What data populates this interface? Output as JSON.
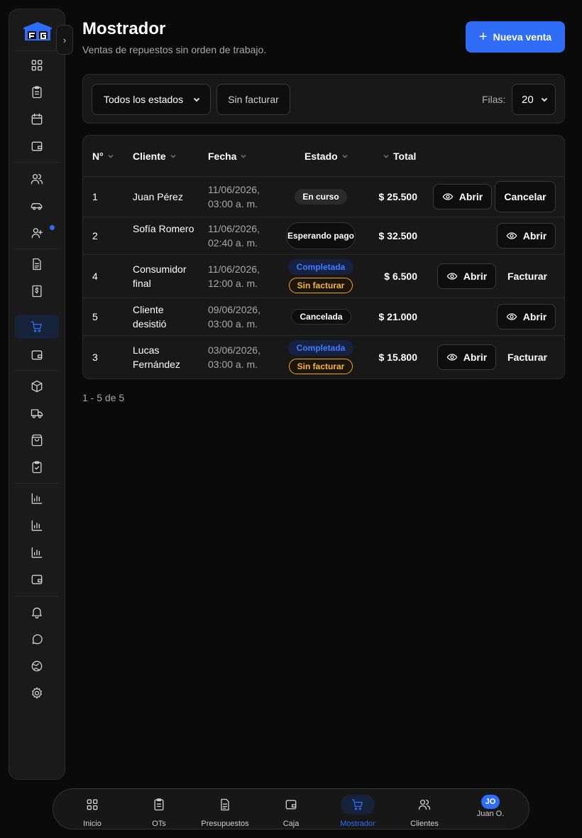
{
  "header": {
    "title": "Mostrador",
    "subtitle": "Ventas de repuestos sin orden de trabajo.",
    "new_sale": "Nueva venta"
  },
  "filters": {
    "estado_selected": "Todos los estados",
    "sin_facturar": "Sin facturar",
    "filas_label": "Filas:",
    "filas_value": "20"
  },
  "table": {
    "columns": {
      "num": "N°",
      "cliente": "Cliente",
      "fecha": "Fecha",
      "estado": "Estado",
      "total": "Total"
    },
    "rows": [
      {
        "num": "1",
        "cliente": "Juan Pérez",
        "fecha": "11/06/2026, 03:00 a. m.",
        "estado": "En curso",
        "total": "$ 25.500",
        "abrir": "Abrir",
        "extra": "Cancelar"
      },
      {
        "num": "2",
        "cliente": "Sofía Romero",
        "fecha": "11/06/2026, 02:40 a. m.",
        "estado": "Esperando pago",
        "total": "$ 32.500",
        "abrir": "Abrir"
      },
      {
        "num": "4",
        "cliente": "Consumidor final",
        "fecha": "11/06/2026, 12:00 a. m.",
        "estado": "Completada",
        "estado2": "Sin facturar",
        "total": "$ 6.500",
        "abrir": "Abrir",
        "extra": "Facturar"
      },
      {
        "num": "5",
        "cliente": "Cliente desistió",
        "fecha": "09/06/2026, 03:00 a. m.",
        "estado": "Cancelada",
        "total": "$ 21.000",
        "abrir": "Abrir"
      },
      {
        "num": "3",
        "cliente": "Lucas Fernández",
        "fecha": "03/06/2026, 03:00 a. m.",
        "estado": "Completada",
        "estado2": "Sin facturar",
        "total": "$ 15.800",
        "abrir": "Abrir",
        "extra": "Facturar"
      }
    ]
  },
  "pagination": "1 - 5 de 5",
  "bottom_nav": {
    "items": [
      "Inicio",
      "OTs",
      "Presupuestos",
      "Caja",
      "Mostrador",
      "Clientes"
    ],
    "user_initials": "JO",
    "user_name": "Juan O."
  },
  "colors": {
    "accent": "#2f6df6",
    "warning": "#f0a420",
    "background": "#0a0a0a"
  }
}
